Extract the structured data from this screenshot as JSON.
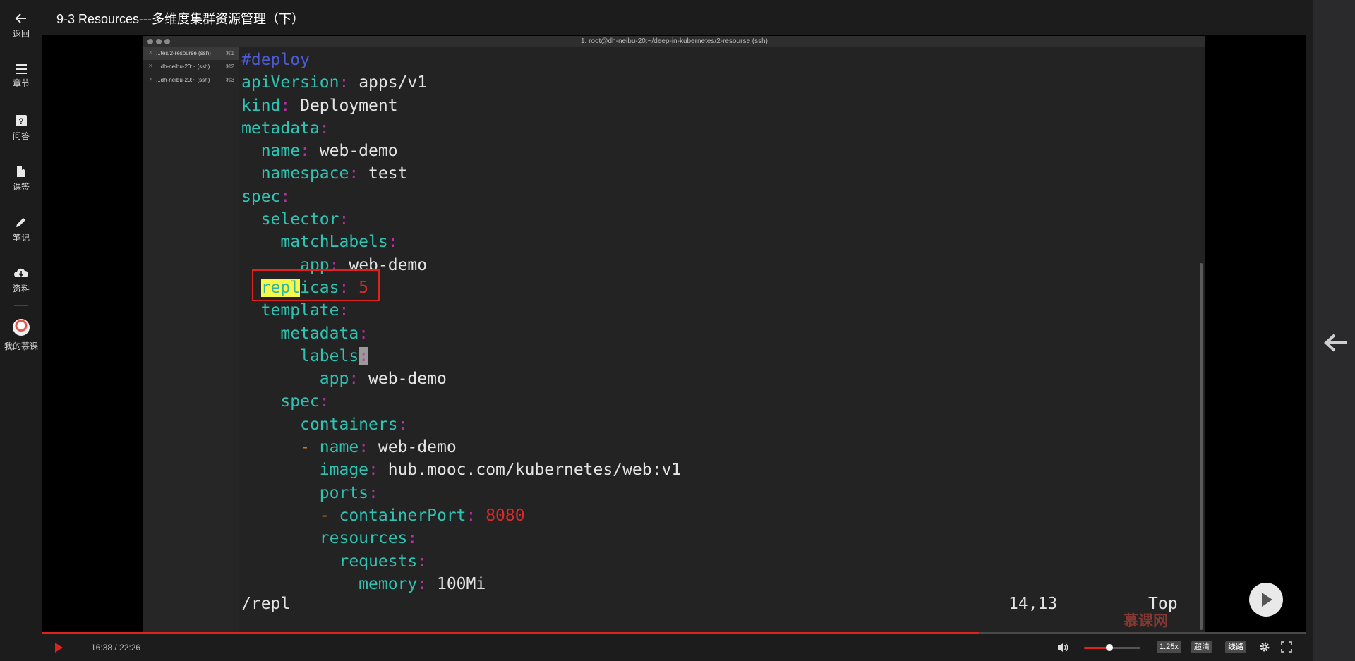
{
  "page": {
    "title": "9-3 Resources---多维度集群资源管理（下）"
  },
  "sidebar": {
    "items": [
      {
        "label": "返回",
        "icon": "back-arrow-icon"
      },
      {
        "label": "章节",
        "icon": "menu-icon"
      },
      {
        "label": "问答",
        "icon": "question-icon"
      },
      {
        "label": "课签",
        "icon": "bookmark-icon"
      },
      {
        "label": "笔记",
        "icon": "pencil-icon"
      },
      {
        "label": "资料",
        "icon": "cloud-download-icon"
      },
      {
        "label": "我的慕课",
        "icon": "avatar"
      }
    ]
  },
  "terminal": {
    "window_title": "1. root@dh-neibu-20:~/deep-in-kubernetes/2-resourse (ssh)",
    "tabs": [
      {
        "label": "...tes/2-resourse (ssh)",
        "shortcut": "⌘1"
      },
      {
        "label": "...dh-neibu-20:~ (ssh)",
        "shortcut": "⌘2"
      },
      {
        "label": "...dh-neibu-20:~ (ssh)",
        "shortcut": "⌘3"
      }
    ],
    "code": {
      "comment": "#deploy",
      "apiVersion_key": "apiVersion",
      "apiVersion_val": "apps/v1",
      "kind_key": "kind",
      "kind_val": "Deployment",
      "metadata_key": "metadata",
      "name_key": "name",
      "name_val": "web-demo",
      "namespace_key": "namespace",
      "namespace_val": "test",
      "spec_key": "spec",
      "selector_key": "selector",
      "matchLabels_key": "matchLabels",
      "app_key": "app",
      "app_val": "web-demo",
      "replicas_hl": "repl",
      "replicas_rest": "icas",
      "replicas_val": "5",
      "template_key": "template",
      "metadata2_key": "metadata",
      "labels_key": "labels",
      "app2_key": "app",
      "app2_val": "web-demo",
      "spec2_key": "spec",
      "containers_key": "containers",
      "cname_key": "name",
      "cname_val": "web-demo",
      "image_key": "image",
      "image_val": "hub.mooc.com/kubernetes/web:v1",
      "ports_key": "ports",
      "containerPort_key": "containerPort",
      "containerPort_val": "8080",
      "resources_key": "resources",
      "requests_key": "requests",
      "memory_key": "memory",
      "memory_val": "100Mi"
    },
    "command_line": "/repl",
    "cursor_position": "14,13",
    "scroll_position": "Top"
  },
  "watermark": "慕课网",
  "player": {
    "time": "16:38 / 22:26",
    "progress": 0.7416,
    "volume": 0.45,
    "speed_label": "1.25x",
    "quality_label": "超清",
    "route_label": "线路"
  }
}
